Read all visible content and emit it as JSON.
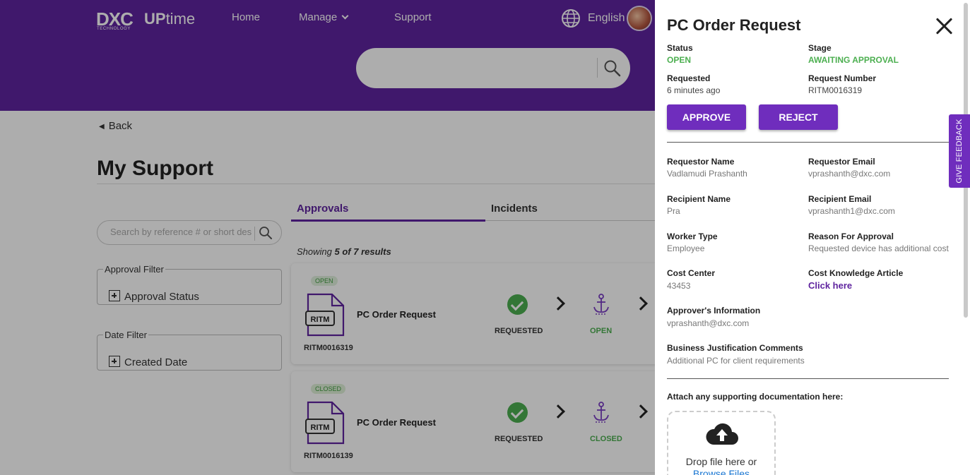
{
  "header": {
    "logo_brand": "DXC",
    "logo_sub": "TECHNOLOGY",
    "logo_product_bold": "UP",
    "logo_product": "time",
    "nav": [
      "Home",
      "Manage",
      "Support"
    ],
    "language": "English"
  },
  "page": {
    "back_label": "Back",
    "title": "My Support",
    "tabs": [
      "Approvals",
      "Incidents"
    ],
    "search_placeholder": "Search by reference # or short desc",
    "filters": [
      {
        "legend": "Approval Filter",
        "option": "Approval Status"
      },
      {
        "legend": "Date Filter",
        "option": "Created Date"
      }
    ],
    "showing_prefix": "Showing",
    "showing_count": "5 of 7 results",
    "cards": [
      {
        "badge": "OPEN",
        "title": "PC Order Request",
        "number": "RITM0016319",
        "stage1": "REQUESTED",
        "stage2": "OPEN"
      },
      {
        "badge": "CLOSED",
        "title": "PC Order Request",
        "number": "RITM0016139",
        "stage1": "REQUESTED",
        "stage2": "CLOSED"
      }
    ],
    "doc_icon_text": "RITM"
  },
  "drawer": {
    "title": "PC Order Request",
    "status_label": "Status",
    "status_value": "OPEN",
    "stage_label": "Stage",
    "stage_value": "AWAITING APPROVAL",
    "requested_label": "Requested",
    "requested_value": "6 minutes ago",
    "request_number_label": "Request Number",
    "request_number_value": "RITM0016319",
    "approve_label": "APPROVE",
    "reject_label": "REJECT",
    "details": {
      "requestor_name_label": "Requestor Name",
      "requestor_name": "Vadlamudi Prashanth",
      "requestor_email_label": "Requestor Email",
      "requestor_email": "vprashanth@dxc.com",
      "recipient_name_label": "Recipient Name",
      "recipient_name": "Pra",
      "recipient_email_label": "Recipient Email",
      "recipient_email": "vprashanth1@dxc.com",
      "worker_type_label": "Worker Type",
      "worker_type": "Employee",
      "reason_label": "Reason For Approval",
      "reason": "Requested device has additional cost",
      "cost_center_label": "Cost Center",
      "cost_center": "43453",
      "cost_article_label": "Cost Knowledge Article",
      "cost_article_link": "Click here",
      "approver_label": "Approver's Information",
      "approver": "vprashanth@dxc.com",
      "justification_label": "Business Justification Comments",
      "justification": "Additional PC for client requirements"
    },
    "attach_label": "Attach any supporting documentation here:",
    "drop_text": "Drop file here or",
    "browse_text": "Browse Files"
  },
  "feedback_label": "GIVE FEEDBACK",
  "colors": {
    "brand_purple": "#5f249f",
    "button_purple": "#6f2dbd",
    "status_green": "#4caf50",
    "link_blue": "#1976d2"
  }
}
